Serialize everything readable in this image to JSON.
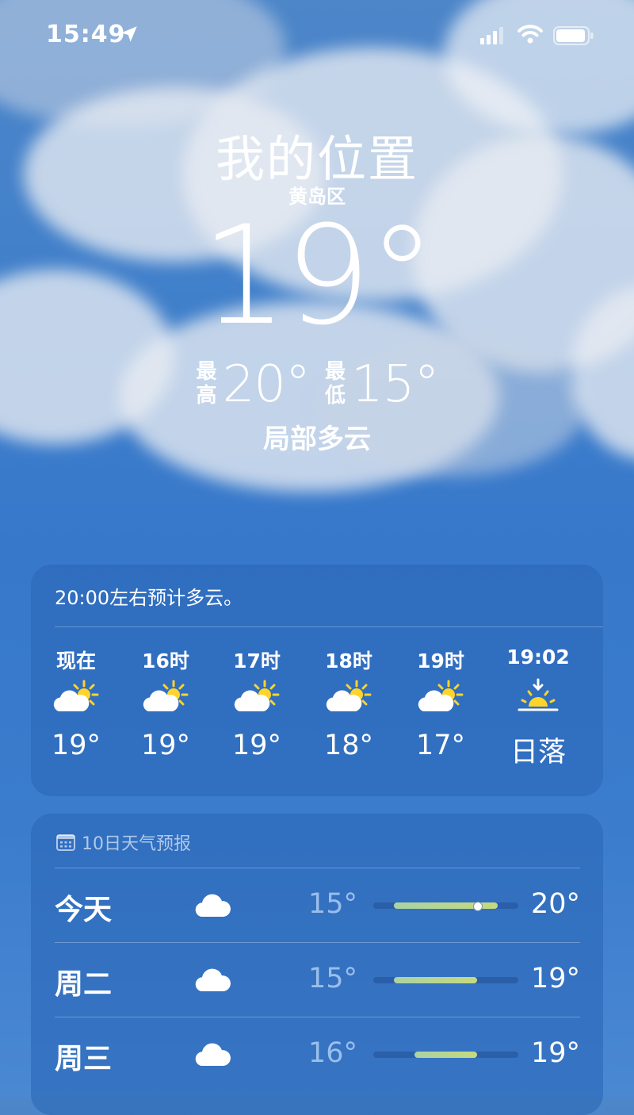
{
  "status_bar": {
    "time": "15:49"
  },
  "location": {
    "title": "我的位置",
    "district": "黄岛区",
    "current_temp": "19°",
    "high_label": "最高",
    "high_value": "20°",
    "low_label": "最低",
    "low_value": "15°",
    "condition": "局部多云"
  },
  "hourly": {
    "summary": "20:00左右预计多云。",
    "items": [
      {
        "label": "现在",
        "icon": "partly-cloudy-icon",
        "temp": "19°"
      },
      {
        "label": "16时",
        "icon": "partly-cloudy-icon",
        "temp": "19°"
      },
      {
        "label": "17时",
        "icon": "partly-cloudy-icon",
        "temp": "19°"
      },
      {
        "label": "18时",
        "icon": "partly-cloudy-icon",
        "temp": "18°"
      },
      {
        "label": "19时",
        "icon": "partly-cloudy-icon",
        "temp": "17°"
      },
      {
        "label": "19:02",
        "icon": "sunset-icon",
        "temp": "日落"
      }
    ]
  },
  "daily": {
    "header": "10日天气预报",
    "range_low": 14,
    "range_high": 21,
    "days": [
      {
        "name": "今天",
        "icon": "cloud-icon",
        "low_text": "15°",
        "high_text": "20°",
        "low": 15,
        "high": 20,
        "current": 19
      },
      {
        "name": "周二",
        "icon": "cloud-icon",
        "low_text": "15°",
        "high_text": "19°",
        "low": 15,
        "high": 19
      },
      {
        "name": "周三",
        "icon": "cloud-icon",
        "low_text": "16°",
        "high_text": "19°",
        "low": 16,
        "high": 19
      }
    ]
  },
  "colors": {
    "sky": "#3778cb",
    "card": "#2c68b8",
    "sun": "#ffd42a",
    "bar": "#c6d97d"
  }
}
